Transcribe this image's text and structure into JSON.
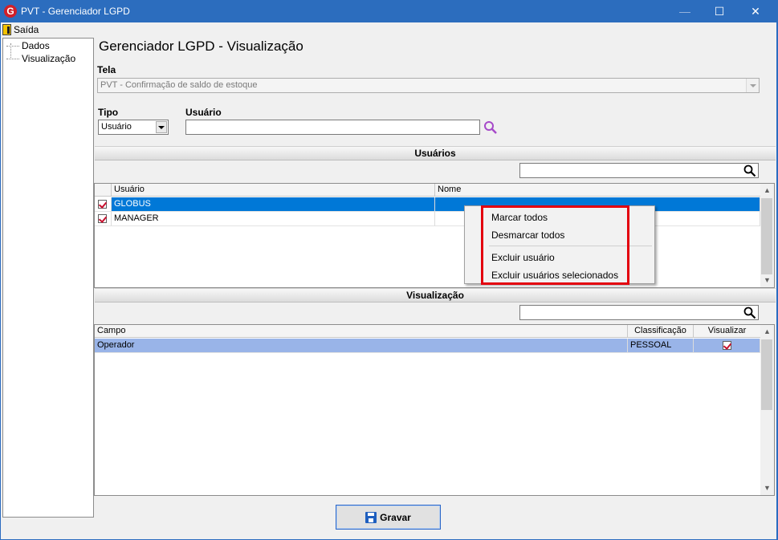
{
  "window": {
    "title": "PVT - Gerenciador LGPD",
    "app_icon_letter": "G",
    "controls": {
      "minimize": "—",
      "maximize": "☐",
      "close": "✕"
    }
  },
  "menu": {
    "exit_label": "Saída"
  },
  "tree": {
    "items": [
      "Dados",
      "Visualização"
    ]
  },
  "page": {
    "title": "Gerenciador LGPD - Visualização",
    "tela_label": "Tela",
    "tela_value": "PVT - Confirmação de saldo de estoque",
    "tipo_label": "Tipo",
    "tipo_value": "Usuário",
    "usuario_label": "Usuário",
    "usuario_value": ""
  },
  "usuarios_section": {
    "title": "Usuários",
    "filter_value": "",
    "columns": [
      "Usuário",
      "Nome"
    ],
    "rows": [
      {
        "usuario": "GLOBUS",
        "nome": "",
        "checked": true,
        "selected": true
      },
      {
        "usuario": "MANAGER",
        "nome": "",
        "checked": true,
        "selected": false
      }
    ]
  },
  "context_menu": {
    "items": [
      "Marcar todos",
      "Desmarcar todos",
      "Excluir usuário",
      "Excluir usuários selecionados"
    ],
    "highlight_color": "#e3000f"
  },
  "visualizacao_section": {
    "title": "Visualização",
    "filter_value": "",
    "columns": [
      "Campo",
      "Classificação",
      "Visualizar"
    ],
    "rows": [
      {
        "campo": "Operador",
        "classificacao": "PESSOAL",
        "visualizar": true,
        "selected": true
      }
    ]
  },
  "footer": {
    "save_label": "Gravar"
  },
  "colors": {
    "titlebar": "#2c6dbe",
    "selection_blue": "#0078d7",
    "selection_light": "#99b4e8",
    "check_red": "#c8102e"
  }
}
